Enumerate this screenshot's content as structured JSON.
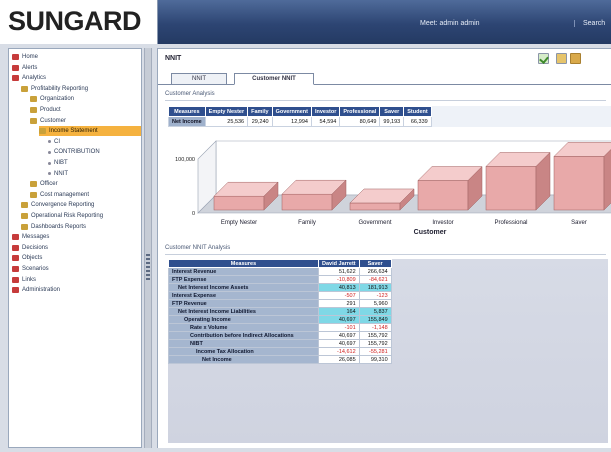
{
  "app": {
    "logo": "SUNGARD",
    "welcome": "Meet: admin admin",
    "search_label": "Search"
  },
  "nav": {
    "items": [
      {
        "label": "Home",
        "icon": "home-icon",
        "level": 0
      },
      {
        "label": "Alerts",
        "icon": "alert-icon",
        "level": 0
      },
      {
        "label": "Analytics",
        "icon": "analytics-icon",
        "level": 0
      },
      {
        "label": "Profitability Reporting",
        "icon": "folder-icon",
        "level": 1
      },
      {
        "label": "Organization",
        "icon": "folder-icon",
        "level": 2
      },
      {
        "label": "Product",
        "icon": "folder-icon",
        "level": 2
      },
      {
        "label": "Customer",
        "icon": "folder-icon",
        "level": 2
      },
      {
        "label": "Income Statement",
        "icon": "report-icon",
        "level": 3,
        "selected": true
      },
      {
        "label": "CI",
        "icon": "bullet-icon",
        "level": 4
      },
      {
        "label": "CONTRIBUTION",
        "icon": "bullet-icon",
        "level": 4
      },
      {
        "label": "NIBT",
        "icon": "bullet-icon",
        "level": 4
      },
      {
        "label": "NNIT",
        "icon": "bullet-icon",
        "level": 4
      },
      {
        "label": "Officer",
        "icon": "folder-icon",
        "level": 2
      },
      {
        "label": "Cost management",
        "icon": "folder-icon",
        "level": 2
      },
      {
        "label": "Convergence Reporting",
        "icon": "folder-icon",
        "level": 1
      },
      {
        "label": "Operational Risk Reporting",
        "icon": "folder-icon",
        "level": 1
      },
      {
        "label": "Dashboards Reports",
        "icon": "folder-icon",
        "level": 1
      },
      {
        "label": "Messages",
        "icon": "messages-icon",
        "level": 0
      },
      {
        "label": "Decisions",
        "icon": "decisions-icon",
        "level": 0
      },
      {
        "label": "Objects",
        "icon": "objects-icon",
        "level": 0
      },
      {
        "label": "Scenarios",
        "icon": "scenarios-icon",
        "level": 0
      },
      {
        "label": "Links",
        "icon": "links-icon",
        "level": 0
      },
      {
        "label": "Administration",
        "icon": "admin-icon",
        "level": 0
      }
    ]
  },
  "content": {
    "title": "NNIT",
    "tabs": [
      {
        "label": "NNIT"
      },
      {
        "label": "Customer NNIT"
      }
    ],
    "active_tab": "Customer NNIT",
    "section1": "Customer Analysis",
    "section2": "Customer NNIT Analysis"
  },
  "summary_table": {
    "headers": [
      "Measures",
      "Empty Nester",
      "Family",
      "Government",
      "Investor",
      "Professional",
      "Saver",
      "Student"
    ],
    "row_label": "Net Income",
    "values": [
      "25,536",
      "29,240",
      "12,994",
      "54,594",
      "80,649",
      "99,193",
      "66,339"
    ]
  },
  "chart_data": {
    "type": "bar",
    "style": "3d",
    "categories": [
      "Empty Nester",
      "Family",
      "Government",
      "Investor",
      "Professional",
      "Saver"
    ],
    "values": [
      25536,
      29240,
      12994,
      54594,
      80649,
      99193
    ],
    "xlabel": "Customer",
    "ytick_labels": [
      "100,000",
      "0"
    ],
    "ylim": [
      0,
      100000
    ],
    "colors": {
      "bar_front": "#e8a9a9",
      "bar_top": "#f4cccc",
      "bar_side": "#c98585",
      "wall": "#ffffff",
      "floor": "#cfd3db"
    }
  },
  "analysis": {
    "headers": [
      "Measures",
      "David Jarrett",
      "Saver"
    ],
    "rows": [
      {
        "label": "Interest Revenue",
        "indent": 0,
        "v1": "51,622",
        "v2": "266,634",
        "hl": false
      },
      {
        "label": "FTP Expense",
        "indent": 0,
        "v1": "-10,809",
        "v2": "-84,621",
        "neg1": true,
        "neg2": true,
        "hl": false
      },
      {
        "label": "Net Interest Income Assets",
        "indent": 1,
        "v1": "40,813",
        "v2": "181,913",
        "hl": true
      },
      {
        "label": "Interest Expense",
        "indent": 0,
        "v1": "-507",
        "v2": "-123",
        "neg1": true,
        "neg2": true,
        "hl": false
      },
      {
        "label": "FTP Revenue",
        "indent": 0,
        "v1": "291",
        "v2": "5,960",
        "hl": false
      },
      {
        "label": "Net Interest Income Liabilities",
        "indent": 1,
        "v1": "164",
        "v2": "5,837",
        "hl": true
      },
      {
        "label": "Operating Income",
        "indent": 2,
        "v1": "40,697",
        "v2": "155,849",
        "hl": true
      },
      {
        "label": "Rate x Volume",
        "indent": 3,
        "v1": "-101",
        "v2": "-1,148",
        "neg1": true,
        "neg2": true,
        "hl": false
      },
      {
        "label": "Contribution before Indirect Allocations",
        "indent": 3,
        "v1": "40,697",
        "v2": "155,792",
        "hl": false
      },
      {
        "label": "NIBT",
        "indent": 3,
        "v1": "40,697",
        "v2": "155,792",
        "hl": false
      },
      {
        "label": "Income Tax Allocation",
        "indent": 4,
        "v1": "-14,612",
        "v2": "-55,281",
        "neg1": true,
        "neg2": true,
        "hl": false
      },
      {
        "label": "Net Income",
        "indent": 5,
        "v1": "26,085",
        "v2": "99,310",
        "hl": false
      }
    ]
  }
}
